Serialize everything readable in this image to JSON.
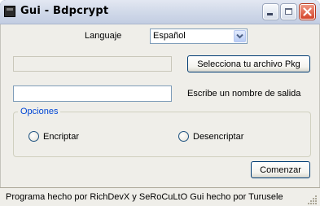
{
  "window": {
    "title": "Gui - Bdpcrypt",
    "minimize_icon": "minimize-icon",
    "maximize_icon": "maximize-icon",
    "close_icon": "close-icon"
  },
  "language": {
    "label": "Languaje",
    "selected": "Español"
  },
  "file": {
    "path_value": "",
    "select_button": "Selecciona tu archivo Pkg"
  },
  "output": {
    "name_value": "",
    "label": "Escribe un nombre de salida"
  },
  "options": {
    "legend": "Opciones",
    "encrypt_label": "Encriptar",
    "decrypt_label": "Desencriptar",
    "encrypt_selected": false,
    "decrypt_selected": false
  },
  "actions": {
    "start_button": "Comenzar"
  },
  "statusbar": {
    "text": "Programa hecho por RichDevX y SeRoCuLtO  Gui hecho por Turusele"
  },
  "colors": {
    "accent": "#0046d5",
    "close_button": "#d4452a",
    "window_bg": "#efeee9"
  }
}
